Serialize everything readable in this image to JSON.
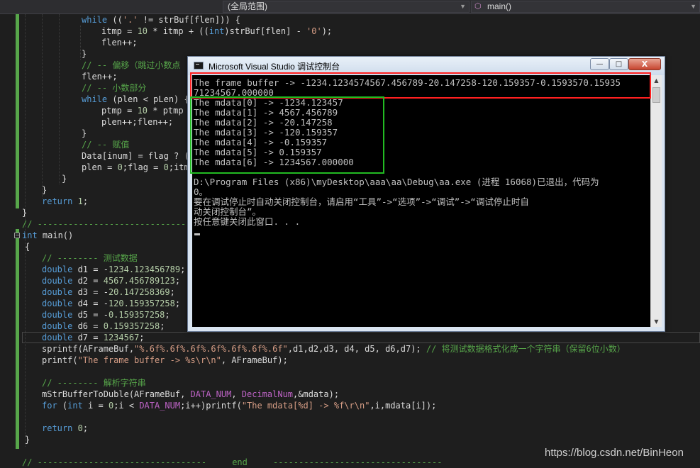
{
  "nav": {
    "scope_label": "(全局范围)",
    "function_label": "main()",
    "function_icon": "cube-icon"
  },
  "code": {
    "lines": [
      {
        "parts": [
          {
            "c": "kw",
            "t": "while"
          },
          {
            "c": "",
            "t": " (("
          },
          {
            "c": "st",
            "t": "'.'"
          },
          {
            "c": "",
            "t": " != strBuf[flen])) {"
          }
        ]
      },
      {
        "parts": [
          {
            "c": "",
            "t": "itmp = "
          },
          {
            "c": "nu",
            "t": "10"
          },
          {
            "c": "",
            "t": " * itmp + (("
          },
          {
            "c": "kw",
            "t": "int"
          },
          {
            "c": "",
            "t": ")strBuf[flen] - "
          },
          {
            "c": "st",
            "t": "'0'"
          },
          {
            "c": "",
            "t": ");"
          }
        ]
      },
      {
        "parts": [
          {
            "c": "",
            "t": "flen++;"
          }
        ]
      },
      {
        "parts": [
          {
            "c": "",
            "t": "}"
          }
        ]
      },
      {
        "parts": [
          {
            "c": "cm",
            "t": "// -- 偏移（跳过小数点"
          }
        ]
      },
      {
        "parts": [
          {
            "c": "",
            "t": "flen++;"
          }
        ]
      },
      {
        "parts": [
          {
            "c": "cm",
            "t": "// -- 小数部分"
          }
        ]
      },
      {
        "parts": [
          {
            "c": "kw",
            "t": "while"
          },
          {
            "c": "",
            "t": " (plen < pLen) {"
          }
        ]
      },
      {
        "parts": [
          {
            "c": "",
            "t": "ptmp = "
          },
          {
            "c": "nu",
            "t": "10"
          },
          {
            "c": "",
            "t": " * ptmp +"
          }
        ]
      },
      {
        "parts": [
          {
            "c": "",
            "t": "plen++;flen++;"
          }
        ]
      },
      {
        "parts": [
          {
            "c": "",
            "t": "}"
          }
        ]
      },
      {
        "parts": [
          {
            "c": "cm",
            "t": "// -- 赋值"
          }
        ]
      },
      {
        "parts": [
          {
            "c": "",
            "t": "Data[inum] = flag ? ("
          }
        ]
      },
      {
        "parts": [
          {
            "c": "",
            "t": "plen = "
          },
          {
            "c": "nu",
            "t": "0"
          },
          {
            "c": "",
            "t": ";flag = "
          },
          {
            "c": "nu",
            "t": "0"
          },
          {
            "c": "",
            "t": ";itmp"
          }
        ]
      },
      {
        "parts": [
          {
            "c": "",
            "t": "}"
          }
        ]
      },
      {
        "parts": [
          {
            "c": "",
            "t": "}"
          }
        ]
      },
      {
        "parts": [
          {
            "c": "kw",
            "t": "return"
          },
          {
            "c": "",
            "t": " "
          },
          {
            "c": "nu",
            "t": "1"
          },
          {
            "c": "",
            "t": ";"
          }
        ]
      },
      {
        "parts": [
          {
            "c": "",
            "t": "}"
          }
        ]
      },
      {
        "parts": [
          {
            "c": "cm",
            "t": "// ------------------------------------"
          }
        ]
      },
      {
        "parts": [
          {
            "c": "kw",
            "t": "int"
          },
          {
            "c": "",
            "t": " main()"
          }
        ]
      },
      {
        "parts": [
          {
            "c": "",
            "t": "{"
          }
        ]
      },
      {
        "parts": [
          {
            "c": "cm",
            "t": "// -------- 测试数据"
          }
        ]
      },
      {
        "parts": [
          {
            "c": "kw",
            "t": "double"
          },
          {
            "c": "",
            "t": " d1 = -"
          },
          {
            "c": "nu",
            "t": "1234.123456789"
          },
          {
            "c": "",
            "t": ";"
          }
        ]
      },
      {
        "parts": [
          {
            "c": "kw",
            "t": "double"
          },
          {
            "c": "",
            "t": " d2 = "
          },
          {
            "c": "nu",
            "t": "4567.456789123"
          },
          {
            "c": "",
            "t": ";"
          }
        ]
      },
      {
        "parts": [
          {
            "c": "kw",
            "t": "double"
          },
          {
            "c": "",
            "t": " d3 = -"
          },
          {
            "c": "nu",
            "t": "20.147258369"
          },
          {
            "c": "",
            "t": ";"
          }
        ]
      },
      {
        "parts": [
          {
            "c": "kw",
            "t": "double"
          },
          {
            "c": "",
            "t": " d4 = -"
          },
          {
            "c": "nu",
            "t": "120.159357258"
          },
          {
            "c": "",
            "t": ";"
          }
        ]
      },
      {
        "parts": [
          {
            "c": "kw",
            "t": "double"
          },
          {
            "c": "",
            "t": " d5 = -"
          },
          {
            "c": "nu",
            "t": "0.159357258"
          },
          {
            "c": "",
            "t": ";"
          }
        ]
      },
      {
        "parts": [
          {
            "c": "kw",
            "t": "double"
          },
          {
            "c": "",
            "t": " d6 = "
          },
          {
            "c": "nu",
            "t": "0.159357258"
          },
          {
            "c": "",
            "t": ";"
          }
        ]
      },
      {
        "parts": [
          {
            "c": "kw",
            "t": "double"
          },
          {
            "c": "",
            "t": " d7 = "
          },
          {
            "c": "nu",
            "t": "1234567"
          },
          {
            "c": "",
            "t": ";"
          }
        ]
      },
      {
        "parts": [
          {
            "c": "",
            "t": "sprintf(AFrameBuf,"
          },
          {
            "c": "st",
            "t": "\"%.6f%.6f%.6f%.6f%.6f%.6f%.6f\""
          },
          {
            "c": "",
            "t": ",d1,d2,d3, d4, d5, d6,d7); "
          },
          {
            "c": "cm",
            "t": "// 将测试数据格式化成一个字符串（保留6位小数）"
          }
        ]
      },
      {
        "parts": [
          {
            "c": "",
            "t": "printf("
          },
          {
            "c": "st",
            "t": "\"The frame buffer -> %s\\r\\n\""
          },
          {
            "c": "",
            "t": ", AFrameBuf);"
          }
        ]
      },
      {
        "parts": [
          {
            "c": "",
            "t": ""
          }
        ]
      },
      {
        "parts": [
          {
            "c": "cm",
            "t": "// -------- 解析字符串"
          }
        ]
      },
      {
        "parts": [
          {
            "c": "",
            "t": "mStrBufferToDuble(AFrameBuf, "
          },
          {
            "c": "mc",
            "t": "DATA_NUM"
          },
          {
            "c": "",
            "t": ", "
          },
          {
            "c": "mc",
            "t": "DecimalNum"
          },
          {
            "c": "",
            "t": ",&mdata);"
          }
        ]
      },
      {
        "parts": [
          {
            "c": "kw",
            "t": "for"
          },
          {
            "c": "",
            "t": " ("
          },
          {
            "c": "kw",
            "t": "int"
          },
          {
            "c": "",
            "t": " i = "
          },
          {
            "c": "nu",
            "t": "0"
          },
          {
            "c": "",
            "t": ";i < "
          },
          {
            "c": "mc",
            "t": "DATA_NUM"
          },
          {
            "c": "",
            "t": ";i++)printf("
          },
          {
            "c": "st",
            "t": "\"The mdata[%d] -> %f\\r\\n\""
          },
          {
            "c": "",
            "t": ",i,mdata[i]);"
          }
        ]
      },
      {
        "parts": [
          {
            "c": "",
            "t": ""
          }
        ]
      },
      {
        "parts": [
          {
            "c": "kw",
            "t": "return"
          },
          {
            "c": "",
            "t": " "
          },
          {
            "c": "nu",
            "t": "0"
          },
          {
            "c": "",
            "t": ";"
          }
        ]
      },
      {
        "parts": [
          {
            "c": "",
            "t": "}"
          }
        ]
      },
      {
        "parts": [
          {
            "c": "",
            "t": ""
          }
        ]
      },
      {
        "parts": [
          {
            "c": "cm",
            "t": "// ---------------------------------     end     ---------------------------------"
          }
        ]
      }
    ]
  },
  "console": {
    "title": "Microsoft Visual Studio 调试控制台",
    "minimize_glyph": "—",
    "maximize_glyph": "□",
    "close_glyph": "X",
    "scroll_up_glyph": "▲",
    "scroll_down_glyph": "▼",
    "lines": [
      "The frame buffer -> -1234.1234574567.456789-20.147258-120.159357-0.1593570.15935",
      "71234567.000000",
      "The mdata[0] -> -1234.123457",
      "The mdata[1] -> 4567.456789",
      "The mdata[2] -> -20.147258",
      "The mdata[3] -> -120.159357",
      "The mdata[4] -> -0.159357",
      "The mdata[5] -> 0.159357",
      "The mdata[6] -> 1234567.000000",
      "",
      "D:\\Program Files (x86)\\myDesktop\\aaa\\aa\\Debug\\aa.exe (进程 16068)已退出，代码为",
      "0。",
      "要在调试停止时自动关闭控制台，请启用“工具”->“选项”->“调试”->“调试停止时自",
      "动关闭控制台”。",
      "按任意键关闭此窗口. . ."
    ]
  },
  "watermark": "https://blog.csdn.net/BinHeon"
}
